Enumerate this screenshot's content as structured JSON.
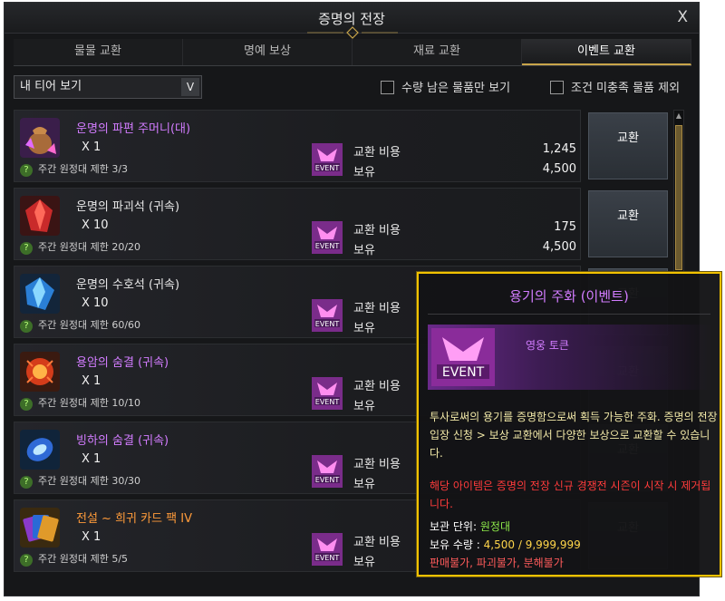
{
  "window": {
    "title": "증명의 전장",
    "close_label": "X"
  },
  "tabs": [
    {
      "label": "물물 교환"
    },
    {
      "label": "명예 보상"
    },
    {
      "label": "재료 교환"
    },
    {
      "label": "이벤트 교환",
      "active": true
    }
  ],
  "filters": {
    "tier_select": "내 티어 보기",
    "caret": "V",
    "only_remaining": "수량 남은 물품만 보기",
    "exclude_unmet": "조건 미충족 물품 제외"
  },
  "common": {
    "cost_label": "교환 비용",
    "own_label": "보유",
    "exchange_button": "교환",
    "help_mark": "?"
  },
  "items": [
    {
      "name": "운명의 파편 주머니(대)",
      "name_color": "purple",
      "qty": "X 1",
      "limit": "주간 원정대 제한 3/3",
      "cost": "1,245",
      "owned": "4,500",
      "icon": "pouch-icon"
    },
    {
      "name": "운명의 파괴석 (귀속)",
      "name_color": "white",
      "qty": "X 10",
      "limit": "주간 원정대 제한 20/20",
      "cost": "175",
      "owned": "4,500",
      "icon": "red-crystal-icon"
    },
    {
      "name": "운명의 수호석 (귀속)",
      "name_color": "white",
      "qty": "X 10",
      "limit": "주간 원정대 제한 60/60",
      "cost": "",
      "owned": "",
      "icon": "blue-crystal-icon"
    },
    {
      "name": "용암의 숨결 (귀속)",
      "name_color": "purple",
      "qty": "X 1",
      "limit": "주간 원정대 제한 10/10",
      "cost": "",
      "owned": "",
      "icon": "lava-breath-icon"
    },
    {
      "name": "빙하의 숨결 (귀속)",
      "name_color": "purple",
      "qty": "X 1",
      "limit": "주간 원정대 제한 30/30",
      "cost": "",
      "owned": "",
      "icon": "glacier-breath-icon"
    },
    {
      "name": "전설 ~ 희귀 카드 팩 IV",
      "name_color": "orange",
      "qty": "X 1",
      "limit": "주간 원정대 제한 5/5",
      "cost": "",
      "owned": "",
      "icon": "card-pack-icon"
    }
  ],
  "tooltip": {
    "title": "용기의 주화 (이벤트)",
    "grade": "영웅 토큰",
    "description": "투사로써의 용기를 증명함으로써 획득 가능한 주화. 증명의 전장 입장 신청 > 보상 교환에서 다양한 보상으로 교환할 수 있습니다.",
    "warning": "해당 아이템은 증명의 전장 신규 경쟁전 시즌이 시작 시 제거됩니다.",
    "storage_label": "보관 단위:",
    "storage_value": "원정대",
    "owned_label": "보유 수량 :",
    "owned_value": "4,500 / 9,999,999",
    "restrictions": "판매불가, 파괴불가, 분해불가"
  },
  "colors": {
    "accent_gold": "#f2c200",
    "purple": "#d27cff",
    "orange": "#ff9b3a",
    "warning_red": "#ff3b3b"
  }
}
